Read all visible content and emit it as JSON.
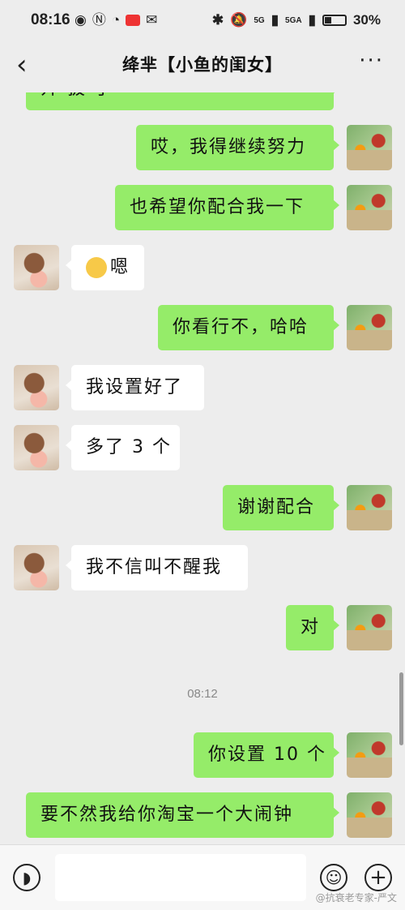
{
  "status_bar": {
    "time": "08:16",
    "signal_1": "5G",
    "signal_2": "5GA",
    "battery": "30%"
  },
  "header": {
    "back_icon": "chevron-left-icon",
    "title": "绛芈【小鱼的闺女】",
    "more_icon": "more-horizontal-icon"
  },
  "chat": {
    "partial_top_text": "开 拔 了",
    "messages": [
      {
        "side": "me",
        "text": "哎，我得继续努力"
      },
      {
        "side": "me",
        "text": "也希望你配合我一下"
      },
      {
        "side": "them",
        "text": "嗯",
        "emoji": "crying-laughing-emoji"
      },
      {
        "side": "me",
        "text": "你看行不，哈哈"
      },
      {
        "side": "them",
        "text": "我设置好了"
      },
      {
        "side": "them",
        "text": "多了 3 个"
      },
      {
        "side": "me",
        "text": "谢谢配合"
      },
      {
        "side": "them",
        "text": "我不信叫不醒我"
      },
      {
        "side": "me",
        "text": "对"
      },
      {
        "side": "me",
        "text": "你设置 10 个"
      },
      {
        "side": "me",
        "text": "要不然我给你淘宝一个大闹钟"
      }
    ],
    "timestamp": "08:12"
  },
  "input_bar": {
    "voice_icon": "voice-icon",
    "placeholder": "",
    "emoji_icon": "smiley-icon",
    "plus_icon": "plus-icon"
  },
  "watermark": "@抗衰老专家-严文",
  "colors": {
    "my_bubble": "#95ec69",
    "their_bubble": "#ffffff",
    "background": "#ededed"
  }
}
